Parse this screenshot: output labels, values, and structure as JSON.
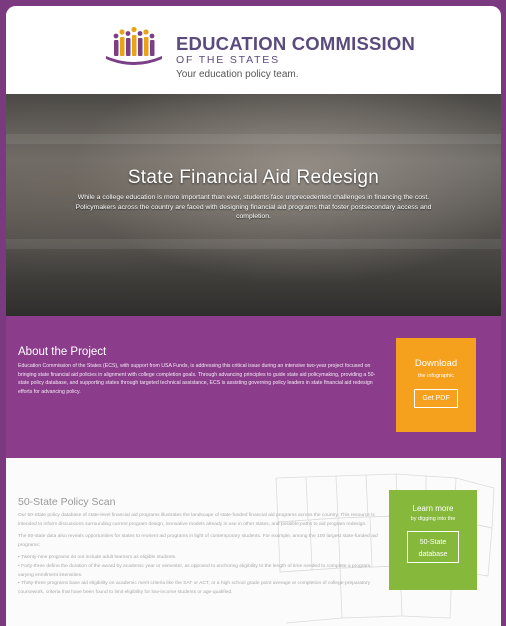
{
  "header": {
    "org_name": "EDUCATION COMMISSION",
    "org_sub": "OF THE STATES",
    "tagline": "Your education policy team."
  },
  "hero": {
    "title": "State Financial Aid Redesign",
    "text": "While a college education is more important than ever, students face unprecedented challenges in financing the cost. Policymakers across the country are faced with designing financial aid programs that foster postsecondary access and completion."
  },
  "about": {
    "title": "About the Project",
    "text": "Education Commission of the States (ECS), with support from USA Funds, is addressing this critical issue during an intensive two-year project focused on bringing state financial aid policies in alignment with college completion goals. Through advancing principles to guide state aid policymaking, providing a 50-state policy database, and supporting states through targeted technical assistance, ECS is assisting governing policy leaders in state financial aid redesign efforts for advancing policy.",
    "download_label": "Download",
    "download_sub": "the infographic",
    "pdf_button": "Get PDF"
  },
  "states": {
    "title": "50-State Policy Scan",
    "intro": "Our 50-State policy database of state-level financial aid programs illustrates the landscape of state-funded financial aid programs across the country. This resource is intended to inform discussions surrounding current program design, innovative models already in use in other states, and possible paths to aid program redesign.",
    "para2": "The 50-state data also reveals opportunities for states to reorient aid programs in light of contemporary students. For example, among the 100 largest state-funded aid programs:",
    "bullets": [
      "Twenty-nine programs do not include adult learners as eligible students.",
      "Forty-three define the duration of the award by academic year or semester, as opposed to anchoring eligibility to the length of time needed to complete a program, varying enrollment intensities.",
      "Thirty-three programs base aid eligibility on academic merit criteria like the SAT or ACT, or a high school grade point average or completion of college-preparatory coursework, criteria that have been found to limit eligibility for low-income students or age-qualified."
    ],
    "learn_label": "Learn more",
    "learn_sub": "by digging into the",
    "db_button_line1": "50-State",
    "db_button_line2": "database"
  },
  "colors": {
    "brand_purple": "#7b3a7f",
    "about_purple": "#8b3d8c",
    "download_orange": "#f5a11d",
    "learn_green": "#86b83b",
    "logo_gold": "#e8a317",
    "logo_purple": "#7a3f86"
  },
  "icons": {
    "logo": "ecs-people-logo-icon"
  }
}
